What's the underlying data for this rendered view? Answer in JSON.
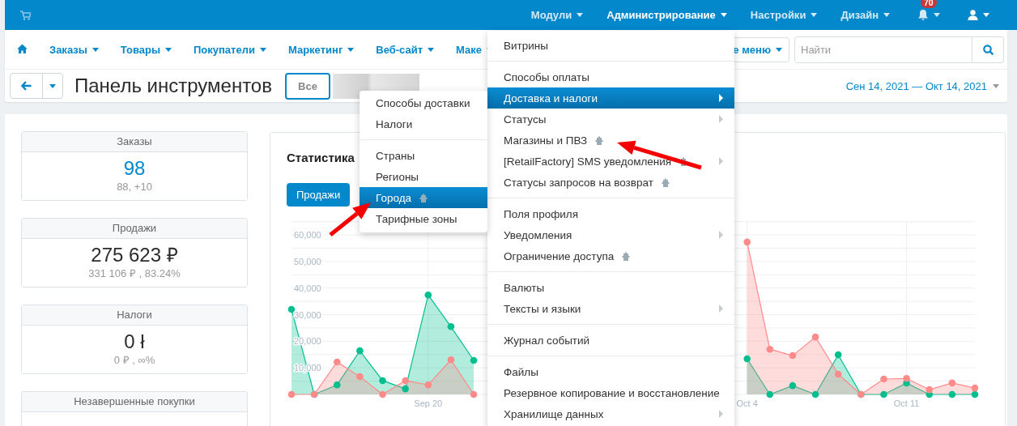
{
  "top_bar": {
    "menus": [
      {
        "label": "Модули",
        "selected": false
      },
      {
        "label": "Администрирование",
        "selected": true
      },
      {
        "label": "Настройки",
        "selected": false
      },
      {
        "label": "Дизайн",
        "selected": false
      }
    ],
    "notifications": {
      "badge": "70"
    }
  },
  "nav": {
    "items": [
      "Заказы",
      "Товары",
      "Покупатели",
      "Маркетинг",
      "Веб-сайт",
      "Маке"
    ],
    "quick_menu": "е меню",
    "search": {
      "placeholder": "Найти"
    }
  },
  "toolbar": {
    "title": "Панель инструментов",
    "filter_button": "Все",
    "date_range": "Сен 14, 2021 — Окт 14, 2021"
  },
  "stats": [
    {
      "title": "Заказы",
      "value": "98",
      "detail": "88, +10",
      "kind": "link"
    },
    {
      "title": "Продажи",
      "value": "275 623 ₽",
      "detail": "331 106 ₽ , 83.24%",
      "kind": "plain"
    },
    {
      "title": "Налоги",
      "value": "0 ł",
      "detail": "0 ₽ , ∞%",
      "kind": "plain"
    },
    {
      "title": "Незавершенные покупки",
      "kind": "plain"
    }
  ],
  "chart_panel": {
    "title": "Статистика",
    "tabs": [
      {
        "label": "Продажи",
        "selected": true
      }
    ],
    "chart_data": {
      "type": "area",
      "categories": [
        null,
        null,
        null,
        null,
        null,
        null,
        "Sep 20",
        null,
        null,
        null,
        null,
        null,
        null,
        null,
        null,
        null,
        null,
        null,
        null,
        null,
        "Oct 4",
        null,
        null,
        null,
        null,
        null,
        null,
        "Oct 11",
        null,
        null,
        null
      ],
      "grid": true,
      "series": [
        {
          "color": "#00bf8f",
          "values": [
            32000,
            0,
            3600,
            16400,
            5200,
            2100,
            37400,
            25500,
            12800,
            null,
            null,
            null,
            null,
            null,
            null,
            null,
            null,
            null,
            null,
            null,
            13400,
            0,
            3300,
            0,
            14900,
            0,
            0,
            4300,
            0,
            0,
            0
          ]
        },
        {
          "color": "#ff8a8a",
          "values": [
            0,
            0,
            12200,
            6700,
            0,
            5200,
            3600,
            13000,
            0,
            null,
            null,
            null,
            null,
            null,
            null,
            null,
            null,
            null,
            null,
            null,
            57300,
            17000,
            14600,
            21600,
            7600,
            0,
            5800,
            6000,
            1800,
            4300,
            2400
          ]
        }
      ],
      "ylim": [
        0,
        65000
      ],
      "yticks": [
        {
          "value": 10000,
          "label": "10,000"
        },
        {
          "value": 20000,
          "label": "20,000"
        },
        {
          "value": 30000,
          "label": "30,000"
        },
        {
          "value": 40000,
          "label": "40,000"
        },
        {
          "value": 50000,
          "label": "50,000"
        },
        {
          "value": 60000,
          "label": "60,000"
        }
      ]
    }
  },
  "admin_menu": {
    "groups": [
      [
        {
          "label": "Витрины",
          "selected": false,
          "has_submenu": false,
          "module": false
        }
      ],
      [
        {
          "label": "Способы оплаты",
          "selected": false,
          "has_submenu": false,
          "module": false
        },
        {
          "label": "Доставка и налоги",
          "selected": true,
          "has_submenu": true,
          "module": false
        },
        {
          "label": "Статусы",
          "selected": false,
          "has_submenu": true,
          "module": false
        },
        {
          "label": "Магазины и ПВЗ",
          "selected": false,
          "has_submenu": false,
          "module": true
        },
        {
          "label": "[RetailFactory] SMS уведомления",
          "selected": false,
          "has_submenu": true,
          "module": true
        },
        {
          "label": "Статусы запросов на возврат",
          "selected": false,
          "has_submenu": false,
          "module": true
        }
      ],
      [
        {
          "label": "Поля профиля",
          "selected": false,
          "has_submenu": false,
          "module": false
        },
        {
          "label": "Уведомления",
          "selected": false,
          "has_submenu": true,
          "module": false
        },
        {
          "label": "Ограничение доступа",
          "selected": false,
          "has_submenu": false,
          "module": true
        }
      ],
      [
        {
          "label": "Валюты",
          "selected": false,
          "has_submenu": false,
          "module": false
        },
        {
          "label": "Тексты и языки",
          "selected": false,
          "has_submenu": true,
          "module": false
        }
      ],
      [
        {
          "label": "Журнал событий",
          "selected": false,
          "has_submenu": false,
          "module": false
        }
      ],
      [
        {
          "label": "Файлы",
          "selected": false,
          "has_submenu": false,
          "module": false
        },
        {
          "label": "Резервное копирование и восстановление",
          "selected": false,
          "has_submenu": false,
          "module": false
        },
        {
          "label": "Хранилище данных",
          "selected": false,
          "has_submenu": true,
          "module": false
        }
      ]
    ]
  },
  "shipping_submenu": {
    "groups": [
      [
        {
          "label": "Способы доставки",
          "selected": false,
          "has_submenu": false,
          "module": false
        },
        {
          "label": "Налоги",
          "selected": false,
          "has_submenu": false,
          "module": false
        }
      ],
      [
        {
          "label": "Страны",
          "selected": false,
          "has_submenu": false,
          "module": false
        },
        {
          "label": "Регионы",
          "selected": false,
          "has_submenu": false,
          "module": false
        },
        {
          "label": "Города",
          "selected": true,
          "has_submenu": false,
          "module": true
        },
        {
          "label": "Тарифные зоны",
          "selected": false,
          "has_submenu": false,
          "module": false
        }
      ]
    ]
  }
}
